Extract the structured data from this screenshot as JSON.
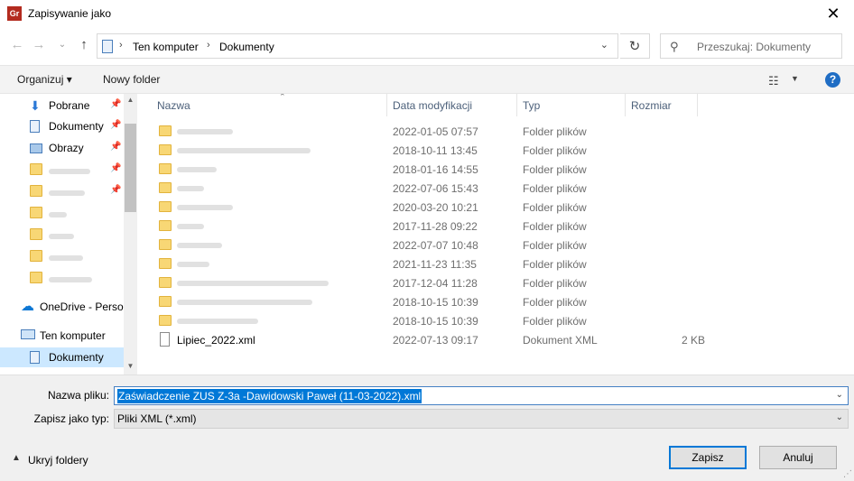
{
  "window": {
    "app_icon_text": "Gr",
    "title": "Zapisywanie jako",
    "close_glyph": "✕"
  },
  "navigation": {
    "back_glyph": "←",
    "forward_glyph": "→",
    "recent_glyph": "⌄",
    "up_glyph": "↑",
    "breadcrumb": [
      "Ten komputer",
      "Dokumenty"
    ],
    "refresh_glyph": "↻",
    "search_placeholder": "Przeszukaj: Dokumenty"
  },
  "toolbar": {
    "organize_label": "Organizuj ▾",
    "new_folder_label": "Nowy folder",
    "help_label": "?"
  },
  "sidebar": {
    "items": [
      {
        "label": "Pobrane",
        "icon": "download-icon",
        "pinned": true
      },
      {
        "label": "Dokumenty",
        "icon": "documents-icon",
        "pinned": true
      },
      {
        "label": "Obrazy",
        "icon": "pictures-icon",
        "pinned": true
      },
      {
        "label": "",
        "icon": "folder-icon",
        "pinned": true
      },
      {
        "label": "",
        "icon": "folder-icon",
        "pinned": true
      },
      {
        "label": "",
        "icon": "folder-icon",
        "pinned": false
      },
      {
        "label": "",
        "icon": "folder-icon",
        "pinned": false
      },
      {
        "label": "",
        "icon": "folder-icon",
        "pinned": false
      },
      {
        "label": "",
        "icon": "folder-icon",
        "pinned": false
      },
      {
        "label": "OneDrive - Perso",
        "icon": "onedrive-icon",
        "pinned": false
      },
      {
        "label": "Ten komputer",
        "icon": "computer-icon",
        "pinned": false
      },
      {
        "label": "Dokumenty",
        "icon": "documents-icon",
        "pinned": false,
        "selected": true
      }
    ]
  },
  "filelist": {
    "columns": [
      "Nazwa",
      "Data modyfikacji",
      "Typ",
      "Rozmiar"
    ],
    "rows": [
      {
        "name": "",
        "date": "2022-01-05 07:57",
        "type": "Folder plików",
        "size": "",
        "kind": "folder"
      },
      {
        "name": "",
        "date": "2018-10-11 13:45",
        "type": "Folder plików",
        "size": "",
        "kind": "folder"
      },
      {
        "name": "",
        "date": "2018-01-16 14:55",
        "type": "Folder plików",
        "size": "",
        "kind": "folder"
      },
      {
        "name": "",
        "date": "2022-07-06 15:43",
        "type": "Folder plików",
        "size": "",
        "kind": "folder"
      },
      {
        "name": "",
        "date": "2020-03-20 10:21",
        "type": "Folder plików",
        "size": "",
        "kind": "folder"
      },
      {
        "name": "",
        "date": "2017-11-28 09:22",
        "type": "Folder plików",
        "size": "",
        "kind": "folder"
      },
      {
        "name": "",
        "date": "2022-07-07 10:48",
        "type": "Folder plików",
        "size": "",
        "kind": "folder"
      },
      {
        "name": "",
        "date": "2021-11-23 11:35",
        "type": "Folder plików",
        "size": "",
        "kind": "folder"
      },
      {
        "name": "",
        "date": "2017-12-04 11:28",
        "type": "Folder plików",
        "size": "",
        "kind": "folder"
      },
      {
        "name": "",
        "date": "2018-10-15 10:39",
        "type": "Folder plików",
        "size": "",
        "kind": "folder"
      },
      {
        "name": "",
        "date": "2018-10-15 10:39",
        "type": "Folder plików",
        "size": "",
        "kind": "folder"
      },
      {
        "name": "Lipiec_2022.xml",
        "date": "2022-07-13 09:17",
        "type": "Dokument XML",
        "size": "2 KB",
        "kind": "xml"
      }
    ]
  },
  "save": {
    "filename_label": "Nazwa pliku:",
    "filename_value": "Zaświadczenie ZUS Z-3a -Dawidowski Paweł (11-03-2022).xml",
    "filetype_label": "Zapisz jako typ:",
    "filetype_value": "Pliki XML (*.xml)",
    "hide_folders_label": "Ukryj foldery",
    "save_button": "Zapisz",
    "cancel_button": "Anuluj"
  },
  "colors": {
    "accent": "#0078d7",
    "selection_bg": "#cce8ff",
    "folder": "#f8d775",
    "header_text": "#4c607a"
  }
}
